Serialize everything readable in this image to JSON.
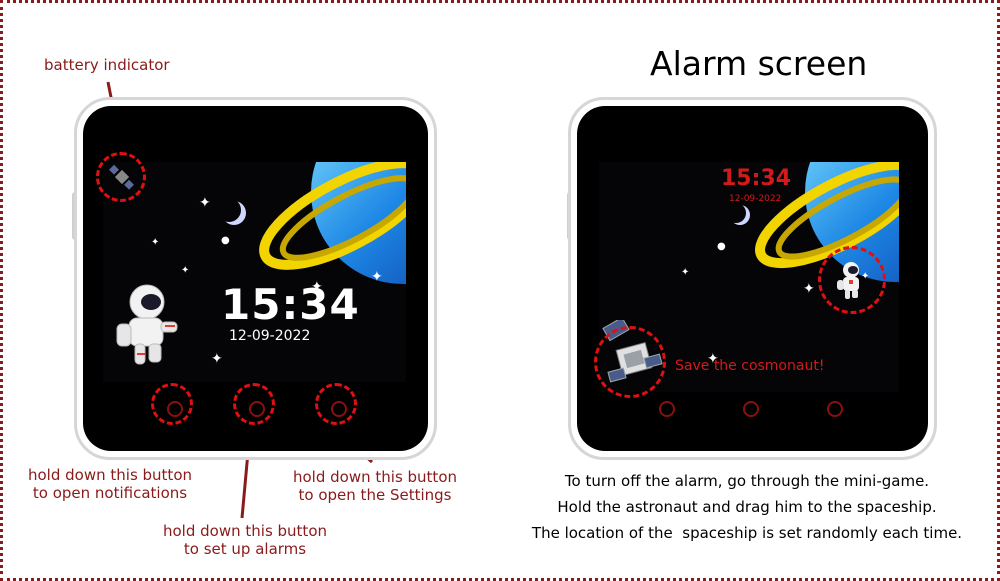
{
  "annotations": {
    "battery": "battery indicator",
    "notif_line1": "hold down this button",
    "notif_line2": "to open notifications",
    "alarm_line1": "hold down this button",
    "alarm_line2": "to set up alarms",
    "settings_line1": "hold down this button",
    "settings_line2": "to open the Settings"
  },
  "home_screen": {
    "time": "15:34",
    "date": "12-09-2022",
    "battery_icon": "satellite-icon",
    "character_icon": "astronaut-icon"
  },
  "alarm_screen": {
    "title": "Alarm screen",
    "time": "15:34",
    "date": "12-09-2022",
    "game_message": "Save the cosmonaut!",
    "astronaut_icon": "astronaut-icon",
    "spaceship_icon": "spaceship-icon"
  },
  "caption": {
    "line1": "To turn off the alarm, go through the mini-game.",
    "line2": "Hold the astronaut and drag him to the spaceship.",
    "line3": "The location of the  spaceship is set randomly each time."
  },
  "colors": {
    "annotation": "#8b1a1a",
    "highlight": "#e01010",
    "alarm_text": "#d21a1a",
    "planet_ring": "#f2d400",
    "planet": "#1e88e5"
  }
}
